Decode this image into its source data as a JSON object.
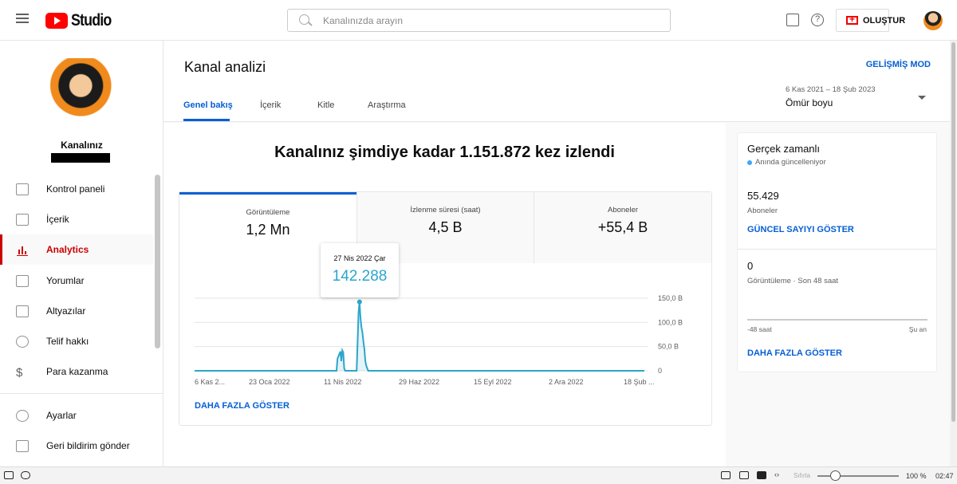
{
  "header": {
    "logo_text": "Studio",
    "search_placeholder": "Kanalınızda arayın",
    "create_label": "OLUŞTUR",
    "help_icon": "?"
  },
  "sidebar": {
    "channel_name": "Kanalınız",
    "items": [
      {
        "label": "Kontrol paneli",
        "icon": "dashboard-icon"
      },
      {
        "label": "İçerik",
        "icon": "content-icon"
      },
      {
        "label": "Analytics",
        "icon": "analytics-icon",
        "active": true
      },
      {
        "label": "Yorumlar",
        "icon": "comments-icon"
      },
      {
        "label": "Altyazılar",
        "icon": "subtitles-icon"
      },
      {
        "label": "Telif hakkı",
        "icon": "copyright-icon"
      },
      {
        "label": "Para kazanma",
        "icon": "dollar-icon"
      }
    ],
    "bottom_items": [
      {
        "label": "Ayarlar",
        "icon": "gear-icon"
      },
      {
        "label": "Geri bildirim gönder",
        "icon": "feedback-icon"
      }
    ]
  },
  "main": {
    "title": "Kanal analizi",
    "advanced_mode": "GELİŞMİŞ MOD",
    "tabs": [
      {
        "label": "Genel bakış",
        "active": true
      },
      {
        "label": "İçerik"
      },
      {
        "label": "Kitle"
      },
      {
        "label": "Araştırma"
      }
    ],
    "date_range": {
      "dates": "6 Kas 2021 – 18 Şub 2023",
      "label": "Ömür boyu"
    },
    "headline": "Kanalınız şimdiye kadar 1.151.872 kez izlendi",
    "metrics": [
      {
        "label": "Görüntüleme",
        "value": "1,2 Mn"
      },
      {
        "label": "İzlenme süresi (saat)",
        "value": "4,5 B"
      },
      {
        "label": "Aboneler",
        "value": "+55,4 B"
      }
    ],
    "tooltip": {
      "date": "27 Nis 2022 Çar",
      "value": "142.288"
    },
    "show_more": "DAHA FAZLA GÖSTER"
  },
  "chart_data": {
    "type": "area",
    "color": "#2ba6cb",
    "x_ticks": [
      "6 Kas 2...",
      "23 Oca 2022",
      "11 Nis 2022",
      "29 Haz 2022",
      "15 Eyl 2022",
      "2 Ara 2022",
      "18 Şub ..."
    ],
    "y_ticks": [
      "150,0 B",
      "100,0 B",
      "50,0 B",
      "0"
    ],
    "ylim": [
      0,
      150000
    ],
    "xlim": [
      "2021-11-06",
      "2023-02-18"
    ],
    "grid": true,
    "series": [
      {
        "points": [
          [
            "2021-11-06",
            0
          ],
          [
            "2022-04-03",
            0
          ],
          [
            "2022-04-04",
            25000
          ],
          [
            "2022-04-06",
            35000
          ],
          [
            "2022-04-07",
            40000
          ],
          [
            "2022-04-08",
            20000
          ],
          [
            "2022-04-09",
            42000
          ],
          [
            "2022-04-10",
            38000
          ],
          [
            "2022-04-11",
            5000
          ],
          [
            "2022-04-12",
            0
          ],
          [
            "2022-04-24",
            0
          ],
          [
            "2022-04-25",
            60000
          ],
          [
            "2022-04-26",
            120000
          ],
          [
            "2022-04-27",
            142288
          ],
          [
            "2022-04-28",
            110000
          ],
          [
            "2022-04-29",
            90000
          ],
          [
            "2022-04-30",
            80000
          ],
          [
            "2022-05-01",
            60000
          ],
          [
            "2022-05-02",
            45000
          ],
          [
            "2022-05-03",
            20000
          ],
          [
            "2022-05-04",
            10000
          ],
          [
            "2022-05-06",
            0
          ],
          [
            "2023-02-18",
            0
          ]
        ]
      }
    ]
  },
  "realtime": {
    "title": "Gerçek zamanlı",
    "status": "Anında güncelleniyor",
    "subscribers": "55.429",
    "subscribers_label": "Aboneler",
    "show_count": "GÜNCEL SAYIYI GÖSTER",
    "views": "0",
    "views_label": "Görüntüleme · Son 48 saat",
    "axis_start": "-48 saat",
    "axis_end": "Şu an",
    "show_more": "DAHA FAZLA GÖSTER",
    "status_color": "#3ea6ff"
  },
  "taskbar": {
    "reset": "Sıfırla",
    "zoom": "100 %",
    "zoom_level": 0.1,
    "time": "02:47"
  }
}
